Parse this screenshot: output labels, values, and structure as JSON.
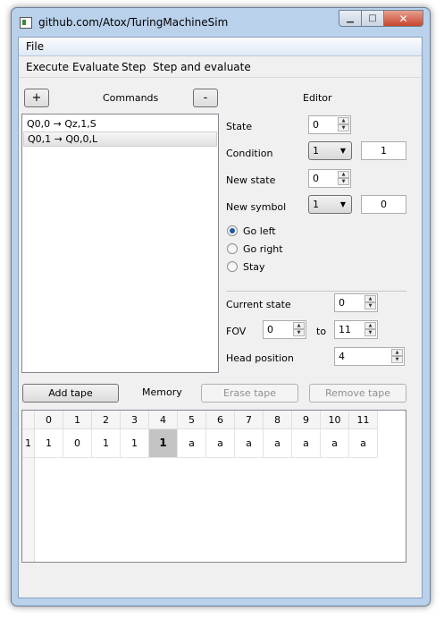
{
  "window": {
    "title": "github.com/Atox/TuringMachineSim"
  },
  "menu": {
    "file": "File"
  },
  "toolbar": {
    "execute": "Execute",
    "evaluate": "Evaluate",
    "step": "Step",
    "step_and_evaluate": "Step and evaluate"
  },
  "commands": {
    "add_label": "+",
    "title": "Commands",
    "remove_label": "-",
    "items": [
      "Q0,0 → Qz,1,S",
      "Q0,1 → Q0,0,L"
    ],
    "selected_index": 1
  },
  "editor": {
    "title": "Editor",
    "state_label": "State",
    "state_value": "0",
    "condition_label": "Condition",
    "condition_select": "1",
    "condition_value": "1",
    "new_state_label": "New state",
    "new_state_value": "0",
    "new_symbol_label": "New symbol",
    "new_symbol_select": "1",
    "new_symbol_value": "0",
    "direction_options": [
      "Go left",
      "Go right",
      "Stay"
    ],
    "direction_selected": "Go left",
    "current_state_label": "Current state",
    "current_state_value": "0",
    "fov_label": "FOV",
    "fov_from": "0",
    "fov_to_label": "to",
    "fov_to": "11",
    "head_position_label": "Head position",
    "head_position_value": "4"
  },
  "memory": {
    "add_tape": "Add tape",
    "title": "Memory",
    "erase_tape": "Erase tape",
    "remove_tape": "Remove tape",
    "columns": [
      "0",
      "1",
      "2",
      "3",
      "4",
      "5",
      "6",
      "7",
      "8",
      "9",
      "10",
      "11"
    ],
    "row_label": "1",
    "cells": [
      "1",
      "0",
      "1",
      "1",
      "1",
      "a",
      "a",
      "a",
      "a",
      "a",
      "a",
      "a"
    ],
    "head_index": 4
  }
}
